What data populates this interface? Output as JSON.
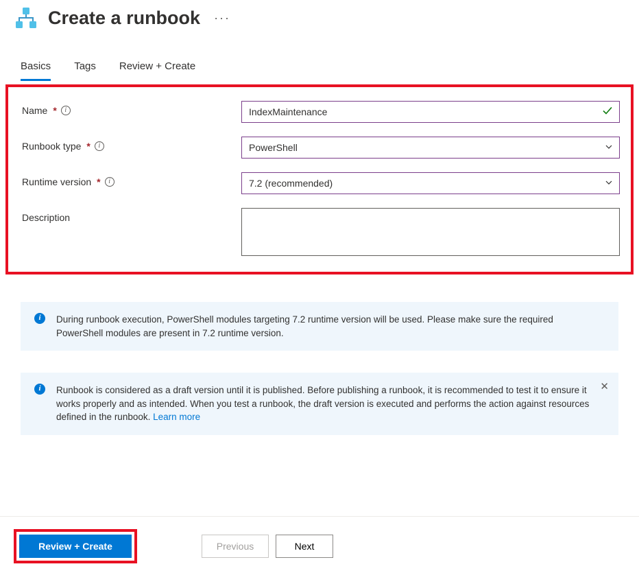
{
  "header": {
    "title": "Create a runbook"
  },
  "tabs": {
    "basics": "Basics",
    "tags": "Tags",
    "review_create": "Review + Create",
    "active": "basics"
  },
  "form": {
    "name": {
      "label": "Name",
      "value": "IndexMaintenance",
      "required": true
    },
    "runbook_type": {
      "label": "Runbook type",
      "value": "PowerShell",
      "required": true
    },
    "runtime_version": {
      "label": "Runtime version",
      "value": "7.2 (recommended)",
      "required": true
    },
    "description": {
      "label": "Description",
      "value": "",
      "required": false
    }
  },
  "callouts": {
    "runtime_info": "During runbook execution, PowerShell modules targeting 7.2 runtime version will be used. Please make sure the required PowerShell modules are present in 7.2 runtime version.",
    "draft_info": "Runbook is considered as a draft version until it is published. Before publishing a runbook, it is recommended to test it to ensure it works properly and as intended. When you test a runbook, the draft version is executed and performs the action against resources defined in the runbook. ",
    "learn_more": "Learn more"
  },
  "footer": {
    "review_create": "Review + Create",
    "previous": "Previous",
    "next": "Next"
  }
}
